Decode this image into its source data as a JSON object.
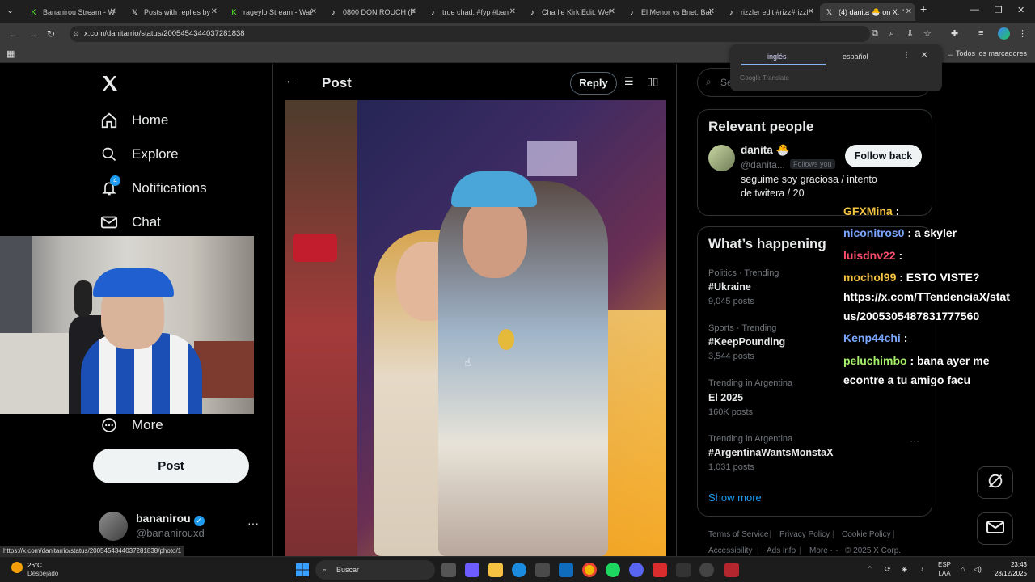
{
  "browser": {
    "tabs": [
      {
        "title": "Bananirou Stream - W",
        "icon": "kick-icon",
        "color": "#53fc18"
      },
      {
        "title": "Posts with replies by",
        "icon": "x-icon",
        "color": "#ffffff"
      },
      {
        "title": "rageylo Stream - Wat",
        "icon": "kick-icon",
        "color": "#53fc18"
      },
      {
        "title": "0800 DON ROUCH (F",
        "icon": "tiktok-icon",
        "color": "#ffffff"
      },
      {
        "title": "true chad. #fyp #ban",
        "icon": "tiktok-icon",
        "color": "#ffffff"
      },
      {
        "title": "Charlie Kirk Edit: Wel",
        "icon": "tiktok-icon",
        "color": "#ffffff"
      },
      {
        "title": "El Menor vs Bnet: Bat",
        "icon": "tiktok-icon",
        "color": "#ffffff"
      },
      {
        "title": "rizzler edit #rizz#rizzl",
        "icon": "tiktok-icon",
        "color": "#ffffff"
      },
      {
        "title": "(4) danita 🐣 on X: \"",
        "icon": "x-icon",
        "color": "#ffffff"
      }
    ],
    "new_tab": "+",
    "url": "x.com/danitarrio/status/2005454344037281838",
    "bookmarks_all": "Todos los marcadores",
    "status_url": "https://x.com/danitarrio/status/2005454344037281838/photo/1"
  },
  "translate_popup": {
    "lang_source": "inglés",
    "lang_target": "español",
    "provider": "Google Translate"
  },
  "sidebar": {
    "items": [
      {
        "label": "Home",
        "icon": "home-icon"
      },
      {
        "label": "Explore",
        "icon": "search-icon"
      },
      {
        "label": "Notifications",
        "icon": "bell-icon",
        "badge": "4"
      },
      {
        "label": "Chat",
        "icon": "mail-icon"
      },
      {
        "label": "More",
        "icon": "more-circle-icon"
      }
    ],
    "post_button": "Post",
    "account": {
      "name": "bananirou",
      "handle": "@bananirouxd",
      "more": "···"
    }
  },
  "post": {
    "header_title": "Post",
    "reply_button": "Reply"
  },
  "search": {
    "placeholder": "Se"
  },
  "relevant_people": {
    "title": "Relevant people",
    "person": {
      "name": "danita 🐣",
      "handle": "@danita...",
      "follows_you": "Follows you",
      "bio": "seguime soy graciosa / intento de twitera / 20",
      "follow_button": "Follow back"
    }
  },
  "whats_happening": {
    "title": "What’s happening",
    "trends": [
      {
        "meta": "Politics · Trending",
        "name": "#Ukraine",
        "count": "9,045 posts"
      },
      {
        "meta": "Sports · Trending",
        "name": "#KeepPounding",
        "count": "3,544 posts"
      },
      {
        "meta": "Trending in Argentina",
        "name": "El 2025",
        "count": "160K posts"
      },
      {
        "meta": "Trending in Argentina",
        "name": "#ArgentinaWantsMonstaX",
        "count": "1,031 posts"
      }
    ],
    "show_more": "Show more"
  },
  "footer": {
    "links": [
      "Terms of Service",
      "Privacy Policy",
      "Cookie Policy",
      "Accessibility",
      "Ads info",
      "More ···",
      "© 2025 X Corp."
    ]
  },
  "stream_chat": {
    "messages": [
      {
        "user": "GFXMina",
        "text": ":",
        "color": "#f5c542"
      },
      {
        "user": "niconitros0",
        "text": ": a skyler",
        "color": "#7aa7ff"
      },
      {
        "user": "luisdnv22",
        "text": ":",
        "color": "#ff4d6d"
      },
      {
        "user": "mochol99",
        "text": ": ESTO VISTE?",
        "color": "#f5c542"
      },
      {
        "user": "",
        "text": "https://x.com/TTendenciaX/stat",
        "color": "#ffffff"
      },
      {
        "user": "",
        "text": "us/2005305487831777560",
        "color": "#ffffff"
      },
      {
        "user": "Kenp44chi",
        "text": ":",
        "color": "#7aa7ff"
      },
      {
        "user": "peluchimbo",
        "text": ": bana ayer me",
        "color": "#a6f06a"
      },
      {
        "user": "",
        "text": "econtre a tu amigo facu",
        "color": "#ffffff"
      }
    ]
  },
  "taskbar": {
    "weather_temp": "26°C",
    "weather_cond": "Despejado",
    "search_placeholder": "Buscar",
    "lang_top": "ESP",
    "lang_bottom": "LAA",
    "time": "23:43",
    "date": "28/12/2025"
  },
  "colors": {
    "accent": "#1d9bf0",
    "background": "#000000",
    "border": "#2f3336"
  }
}
